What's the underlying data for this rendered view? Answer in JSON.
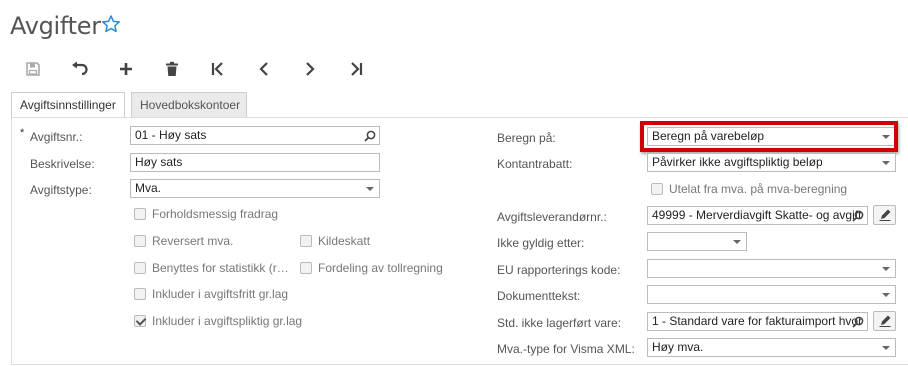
{
  "header": {
    "title": "Avgifter"
  },
  "toolbar": {
    "save": "save-icon",
    "undo": "undo-icon",
    "add": "add-icon",
    "delete": "delete-icon",
    "first": "first-icon",
    "prev": "previous-icon",
    "next": "next-icon",
    "last": "last-icon"
  },
  "tabs": [
    {
      "label": "Avgiftsinnstillinger",
      "active": true
    },
    {
      "label": "Hovedbokskontoer",
      "active": false
    }
  ],
  "left": {
    "required_mark": "*",
    "avgiftsnr": {
      "label": "Avgiftsnr.:",
      "value": "01 - Høy sats"
    },
    "beskrivelse": {
      "label": "Beskrivelse:",
      "value": "Høy sats"
    },
    "avgiftstype": {
      "label": "Avgiftstype:",
      "value": "Mva."
    },
    "checkboxes": {
      "forholdsmessig": {
        "label": "Forholdsmessig fradrag",
        "checked": false
      },
      "reversert": {
        "label": "Reversert mva.",
        "checked": false
      },
      "kildeskatt": {
        "label": "Kildeskatt",
        "checked": false
      },
      "statistikk": {
        "label": "Benyttes for statistikk (r…",
        "checked": false
      },
      "tollregning": {
        "label": "Fordeling av tollregning",
        "checked": false
      },
      "avgiftsfritt": {
        "label": "Inkluder i avgiftsfritt gr.lag",
        "checked": false
      },
      "avgiftspliktig": {
        "label": "Inkluder i avgiftspliktig gr.lag",
        "checked": true
      }
    }
  },
  "right": {
    "beregn": {
      "label": "Beregn på:",
      "value": "Beregn på varebeløp"
    },
    "kontantrabatt": {
      "label": "Kontantrabatt:",
      "value": "Påvirker ikke avgiftspliktig beløp"
    },
    "utelat": {
      "label": "Utelat fra mva. på mva-beregning",
      "checked": false
    },
    "leverandor": {
      "label": "Avgiftsleverandørnr.:",
      "value": "49999 - Merverdiavgift Skatte- og avgift"
    },
    "ikke_gyldig": {
      "label": "Ikke gyldig etter:",
      "value": ""
    },
    "eu_kode": {
      "label": "EU rapporterings kode:",
      "value": ""
    },
    "dokumenttekst": {
      "label": "Dokumenttekst:",
      "value": ""
    },
    "std_vare": {
      "label": "Std. ikke lagerført vare:",
      "value": "1 - Standard vare for fakturaimport hvor"
    },
    "visma_xml": {
      "label": "Mva.-type for Visma XML:",
      "value": "Høy mva."
    }
  },
  "colors": {
    "highlight": "#d00000",
    "star": "#2a8ad4"
  }
}
